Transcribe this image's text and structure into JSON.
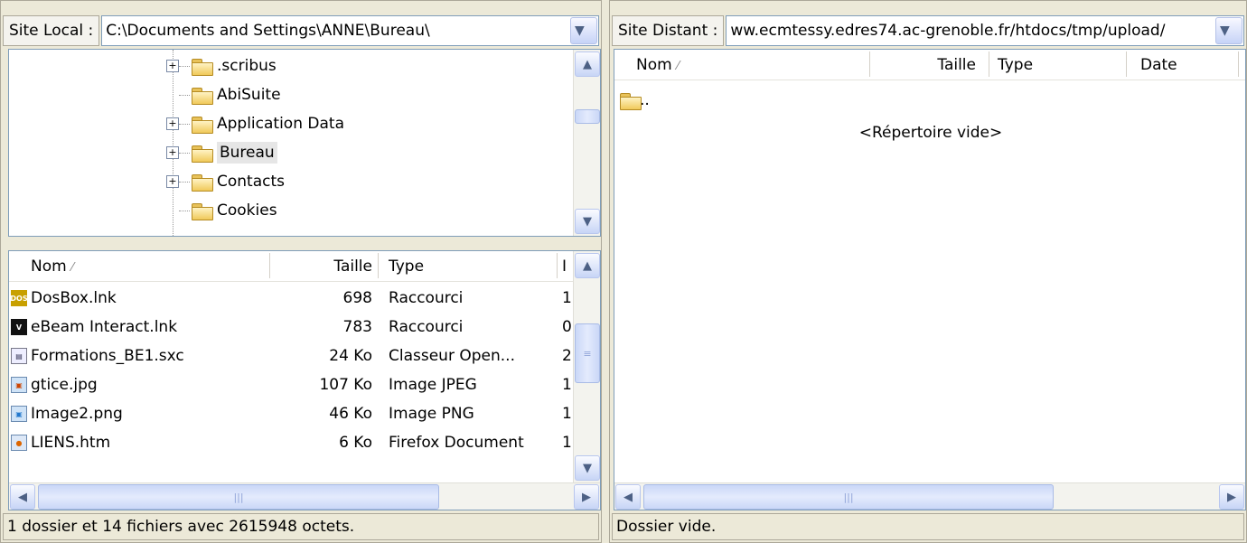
{
  "local": {
    "site_label": "Site Local :",
    "path": "C:\\Documents and Settings\\ANNE\\Bureau\\",
    "tree": [
      {
        "name": ".scribus",
        "expandable": true
      },
      {
        "name": "AbiSuite",
        "expandable": false
      },
      {
        "name": "Application Data",
        "expandable": true
      },
      {
        "name": "Bureau",
        "expandable": true,
        "selected": true
      },
      {
        "name": "Contacts",
        "expandable": true
      },
      {
        "name": "Cookies",
        "expandable": false
      }
    ],
    "columns": {
      "name": "Nom",
      "size": "Taille",
      "type": "Type",
      "date": "I"
    },
    "files": [
      {
        "name": "DosBox.lnk",
        "size": "698",
        "type": "Raccourci",
        "date": "1",
        "icon": "dosbox-icon"
      },
      {
        "name": "eBeam Interact.lnk",
        "size": "783",
        "type": "Raccourci",
        "date": "0",
        "icon": "ebeam-icon"
      },
      {
        "name": "Formations_BE1.sxc",
        "size": "24 Ko",
        "type": "Classeur Open...",
        "date": "2",
        "icon": "spreadsheet-icon"
      },
      {
        "name": "gtice.jpg",
        "size": "107 Ko",
        "type": "Image JPEG",
        "date": "1",
        "icon": "jpeg-icon"
      },
      {
        "name": "Image2.png",
        "size": "46 Ko",
        "type": "Image PNG",
        "date": "1",
        "icon": "png-icon"
      },
      {
        "name": "LIENS.htm",
        "size": "6 Ko",
        "type": "Firefox Document",
        "date": "1",
        "icon": "firefox-doc-icon"
      }
    ],
    "status": "1 dossier et 14 fichiers avec 2615948 octets."
  },
  "remote": {
    "site_label": "Site Distant :",
    "path": "ww.ecmtessy.edres74.ac-grenoble.fr/htdocs/tmp/upload/",
    "columns": {
      "name": "Nom",
      "size": "Taille",
      "type": "Type",
      "date": "Date"
    },
    "parent_entry": "..",
    "empty_message": "<Répertoire vide>",
    "status": "Dossier vide."
  },
  "colors": {
    "panel": "#ece9d8",
    "border": "#7f9db9",
    "scroll": "#c6d3f7"
  }
}
